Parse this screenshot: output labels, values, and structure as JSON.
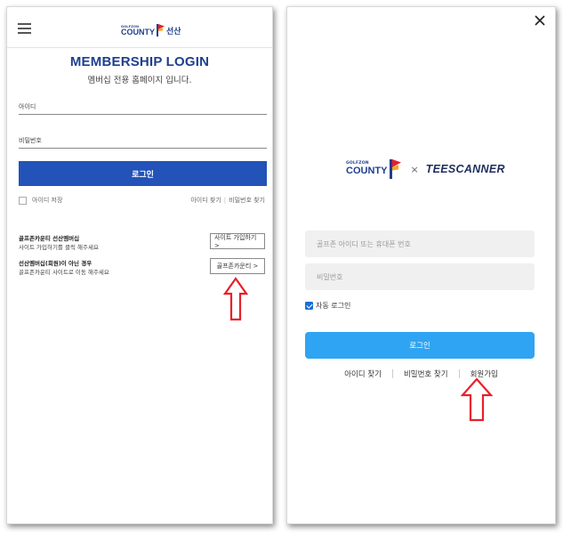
{
  "left_panel": {
    "logo_small": "GOLFZON",
    "logo_main": "COUNTY",
    "logo_suffix": "선산",
    "title": "MEMBERSHIP LOGIN",
    "subtitle": "멤버십 전용 홈페이지 입니다.",
    "id_placeholder": "아이디",
    "pw_placeholder": "비밀번호",
    "login_button": "로그인",
    "save_id_label": "아이디 저장",
    "find_id": "아이디 찾기",
    "link_separator": "|",
    "find_pw": "비밀번호 찾기",
    "info1_title": "골프존카운티 선산멤버십",
    "info1_desc": "사이트 가입하기를 클릭 해주세요",
    "signup_button": "사이트 가입하기 >",
    "info2_title": "선산멤버십(회원)이 아닌 경우",
    "info2_desc": "골프존카운티 사이트로 이동 해주세요",
    "golfzon_button": "골프존카운티 >"
  },
  "right_panel": {
    "logo_small": "GOLFZON",
    "logo_main": "COUNTY",
    "times": "×",
    "partner": "TEESCANNER",
    "id_placeholder": "골프존 아이디 또는 휴대폰 번호",
    "pw_placeholder": "비밀번호",
    "auto_login_label": "자동 로그인",
    "auto_login_checked": true,
    "login_button": "로그인",
    "find_id": "아이디 찾기",
    "find_pw": "비밀번호 찾기",
    "signup": "회원가입"
  },
  "colors": {
    "brand_navy": "#1e3f8f",
    "left_button": "#2352b8",
    "right_button": "#2fa4f2",
    "arrow": "#e8202a",
    "flag_orange": "#f5a623",
    "flag_red": "#e8202a"
  },
  "icons": {
    "menu": "hamburger-icon",
    "close": "close-icon",
    "arrow": "up-arrow-icon",
    "logo_flag": "flag-icon"
  }
}
